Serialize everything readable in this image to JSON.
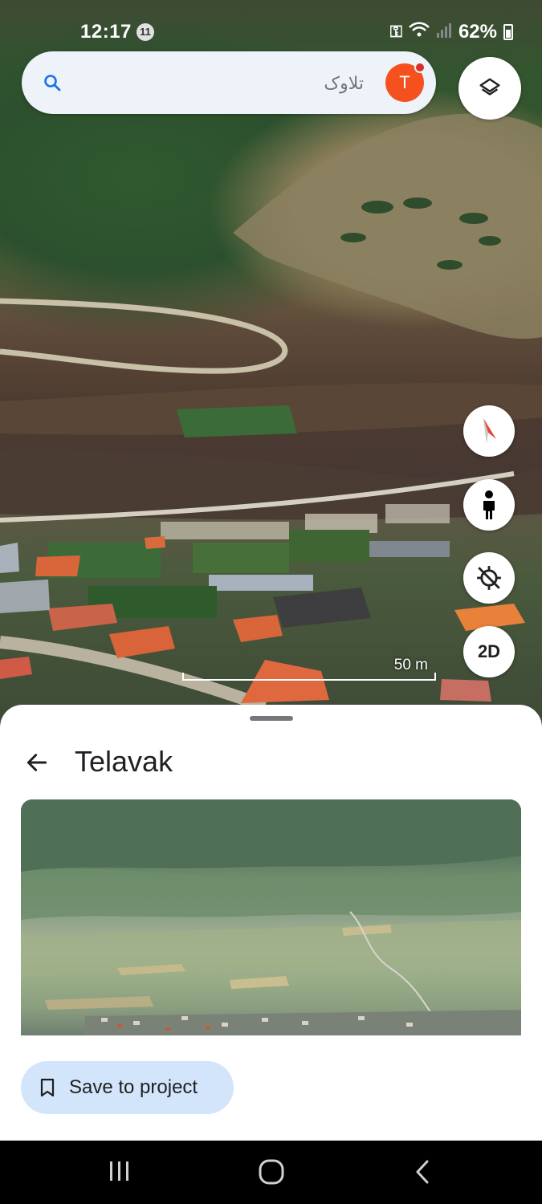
{
  "status_bar": {
    "time": "12:17",
    "notification_count": "11",
    "battery": "62%"
  },
  "search": {
    "placeholder": "تلاوک",
    "avatar_initial": "T"
  },
  "map": {
    "scale_label": "50 m",
    "view_mode_button": "2D"
  },
  "place": {
    "title": "Telavak",
    "save_button": "Save to project"
  },
  "colors": {
    "accent_blue": "#1a73e8",
    "avatar_orange": "#f4511e",
    "chip_blue": "#d3e5fb"
  }
}
